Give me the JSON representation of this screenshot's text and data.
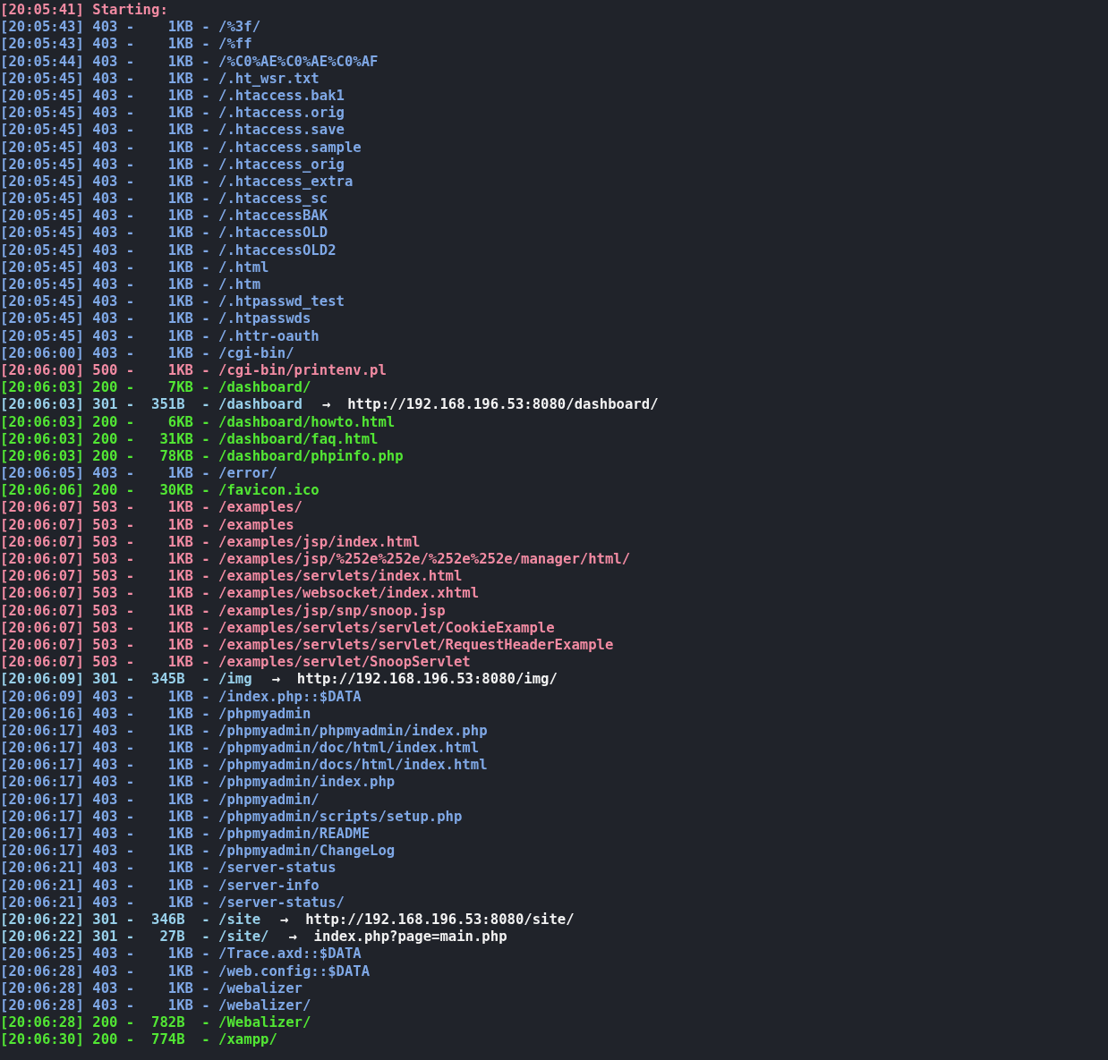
{
  "lines": [
    {
      "kind": "start",
      "text": "[20:05:41] Starting:"
    },
    {
      "kind": "forbidden",
      "text": "[20:05:43] 403 -    1KB - /%3f/"
    },
    {
      "kind": "forbidden",
      "text": "[20:05:43] 403 -    1KB - /%ff"
    },
    {
      "kind": "forbidden",
      "text": "[20:05:44] 403 -    1KB - /%C0%AE%C0%AE%C0%AF"
    },
    {
      "kind": "forbidden",
      "text": "[20:05:45] 403 -    1KB - /.ht_wsr.txt"
    },
    {
      "kind": "forbidden",
      "text": "[20:05:45] 403 -    1KB - /.htaccess.bak1"
    },
    {
      "kind": "forbidden",
      "text": "[20:05:45] 403 -    1KB - /.htaccess.orig"
    },
    {
      "kind": "forbidden",
      "text": "[20:05:45] 403 -    1KB - /.htaccess.save"
    },
    {
      "kind": "forbidden",
      "text": "[20:05:45] 403 -    1KB - /.htaccess.sample"
    },
    {
      "kind": "forbidden",
      "text": "[20:05:45] 403 -    1KB - /.htaccess_orig"
    },
    {
      "kind": "forbidden",
      "text": "[20:05:45] 403 -    1KB - /.htaccess_extra"
    },
    {
      "kind": "forbidden",
      "text": "[20:05:45] 403 -    1KB - /.htaccess_sc"
    },
    {
      "kind": "forbidden",
      "text": "[20:05:45] 403 -    1KB - /.htaccessBAK"
    },
    {
      "kind": "forbidden",
      "text": "[20:05:45] 403 -    1KB - /.htaccessOLD"
    },
    {
      "kind": "forbidden",
      "text": "[20:05:45] 403 -    1KB - /.htaccessOLD2"
    },
    {
      "kind": "forbidden",
      "text": "[20:05:45] 403 -    1KB - /.html"
    },
    {
      "kind": "forbidden",
      "text": "[20:05:45] 403 -    1KB - /.htm"
    },
    {
      "kind": "forbidden",
      "text": "[20:05:45] 403 -    1KB - /.htpasswd_test"
    },
    {
      "kind": "forbidden",
      "text": "[20:05:45] 403 -    1KB - /.htpasswds"
    },
    {
      "kind": "forbidden",
      "text": "[20:05:45] 403 -    1KB - /.httr-oauth"
    },
    {
      "kind": "forbidden",
      "text": "[20:06:00] 403 -    1KB - /cgi-bin/"
    },
    {
      "kind": "error",
      "text": "[20:06:00] 500 -    1KB - /cgi-bin/printenv.pl"
    },
    {
      "kind": "ok",
      "text": "[20:06:03] 200 -    7KB - /dashboard/"
    },
    {
      "kind": "redirect",
      "text": "[20:06:03] 301 -  351B  - /dashboard",
      "target": "→  http://192.168.196.53:8080/dashboard/"
    },
    {
      "kind": "ok",
      "text": "[20:06:03] 200 -    6KB - /dashboard/howto.html"
    },
    {
      "kind": "ok",
      "text": "[20:06:03] 200 -   31KB - /dashboard/faq.html"
    },
    {
      "kind": "ok",
      "text": "[20:06:03] 200 -   78KB - /dashboard/phpinfo.php"
    },
    {
      "kind": "forbidden",
      "text": "[20:06:05] 403 -    1KB - /error/"
    },
    {
      "kind": "ok",
      "text": "[20:06:06] 200 -   30KB - /favicon.ico"
    },
    {
      "kind": "error",
      "text": "[20:06:07] 503 -    1KB - /examples/"
    },
    {
      "kind": "error",
      "text": "[20:06:07] 503 -    1KB - /examples"
    },
    {
      "kind": "error",
      "text": "[20:06:07] 503 -    1KB - /examples/jsp/index.html"
    },
    {
      "kind": "error",
      "text": "[20:06:07] 503 -    1KB - /examples/jsp/%252e%252e/%252e%252e/manager/html/"
    },
    {
      "kind": "error",
      "text": "[20:06:07] 503 -    1KB - /examples/servlets/index.html"
    },
    {
      "kind": "error",
      "text": "[20:06:07] 503 -    1KB - /examples/websocket/index.xhtml"
    },
    {
      "kind": "error",
      "text": "[20:06:07] 503 -    1KB - /examples/jsp/snp/snoop.jsp"
    },
    {
      "kind": "error",
      "text": "[20:06:07] 503 -    1KB - /examples/servlets/servlet/CookieExample"
    },
    {
      "kind": "error",
      "text": "[20:06:07] 503 -    1KB - /examples/servlets/servlet/RequestHeaderExample"
    },
    {
      "kind": "error",
      "text": "[20:06:07] 503 -    1KB - /examples/servlet/SnoopServlet"
    },
    {
      "kind": "redirect",
      "text": "[20:06:09] 301 -  345B  - /img",
      "target": "→  http://192.168.196.53:8080/img/"
    },
    {
      "kind": "forbidden",
      "text": "[20:06:09] 403 -    1KB - /index.php::$DATA"
    },
    {
      "kind": "forbidden",
      "text": "[20:06:16] 403 -    1KB - /phpmyadmin"
    },
    {
      "kind": "forbidden",
      "text": "[20:06:17] 403 -    1KB - /phpmyadmin/phpmyadmin/index.php"
    },
    {
      "kind": "forbidden",
      "text": "[20:06:17] 403 -    1KB - /phpmyadmin/doc/html/index.html"
    },
    {
      "kind": "forbidden",
      "text": "[20:06:17] 403 -    1KB - /phpmyadmin/docs/html/index.html"
    },
    {
      "kind": "forbidden",
      "text": "[20:06:17] 403 -    1KB - /phpmyadmin/index.php"
    },
    {
      "kind": "forbidden",
      "text": "[20:06:17] 403 -    1KB - /phpmyadmin/"
    },
    {
      "kind": "forbidden",
      "text": "[20:06:17] 403 -    1KB - /phpmyadmin/scripts/setup.php"
    },
    {
      "kind": "forbidden",
      "text": "[20:06:17] 403 -    1KB - /phpmyadmin/README"
    },
    {
      "kind": "forbidden",
      "text": "[20:06:17] 403 -    1KB - /phpmyadmin/ChangeLog"
    },
    {
      "kind": "forbidden",
      "text": "[20:06:21] 403 -    1KB - /server-status"
    },
    {
      "kind": "forbidden",
      "text": "[20:06:21] 403 -    1KB - /server-info"
    },
    {
      "kind": "forbidden",
      "text": "[20:06:21] 403 -    1KB - /server-status/"
    },
    {
      "kind": "redirect",
      "text": "[20:06:22] 301 -  346B  - /site",
      "target": "→  http://192.168.196.53:8080/site/"
    },
    {
      "kind": "redirect",
      "text": "[20:06:22] 301 -   27B  - /site/",
      "target": "→  index.php?page=main.php"
    },
    {
      "kind": "forbidden",
      "text": "[20:06:25] 403 -    1KB - /Trace.axd::$DATA"
    },
    {
      "kind": "forbidden",
      "text": "[20:06:28] 403 -    1KB - /web.config::$DATA"
    },
    {
      "kind": "forbidden",
      "text": "[20:06:28] 403 -    1KB - /webalizer"
    },
    {
      "kind": "forbidden",
      "text": "[20:06:28] 403 -    1KB - /webalizer/"
    },
    {
      "kind": "ok",
      "text": "[20:06:28] 200 -  782B  - /Webalizer/"
    },
    {
      "kind": "ok",
      "text": "[20:06:30] 200 -  774B  - /xampp/"
    }
  ]
}
